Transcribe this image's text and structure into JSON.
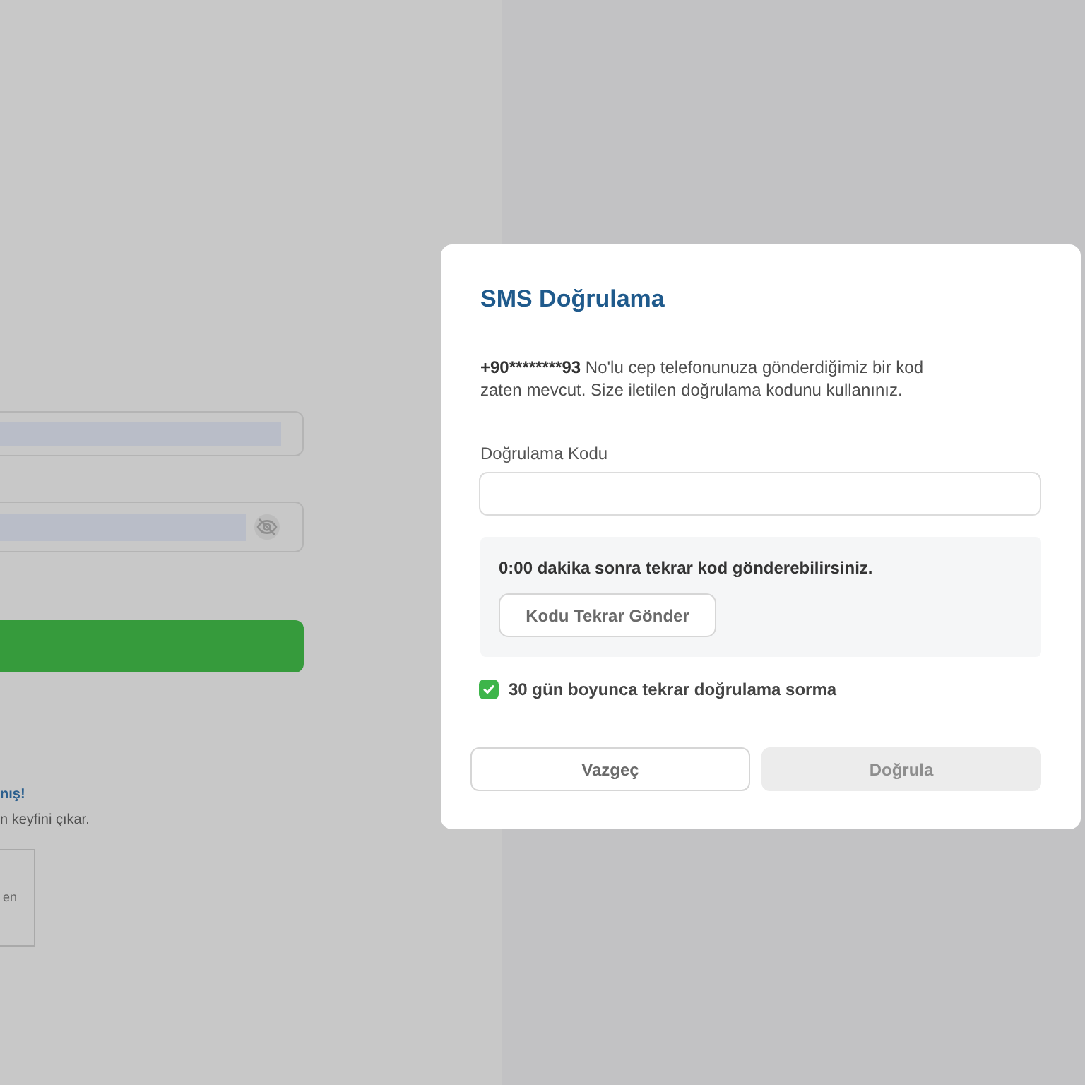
{
  "background_page": {
    "promo_title": "nış!",
    "promo_text": "n keyfini çıkar.",
    "card_text": "en"
  },
  "dialog": {
    "title": "SMS Doğrulama",
    "phone": "+90********93",
    "message": "No'lu cep telefonunuza gönderdiğimiz bir kod zaten mevcut. Size iletilen doğrulama kodunu kullanınız.",
    "code_field": {
      "label": "Doğrulama Kodu"
    },
    "resend": {
      "countdown": "0:00 dakika sonra tekrar kod gönderebilirsiniz.",
      "button": "Kodu Tekrar Gönder"
    },
    "remember": {
      "label": "30 gün boyunca tekrar doğrulama sorma",
      "checked": true
    },
    "buttons": [
      {
        "kind": "cancel",
        "label": "Vazgeç",
        "disabled": false
      },
      {
        "kind": "verify",
        "label": "Doğrula",
        "disabled": true
      }
    ]
  }
}
